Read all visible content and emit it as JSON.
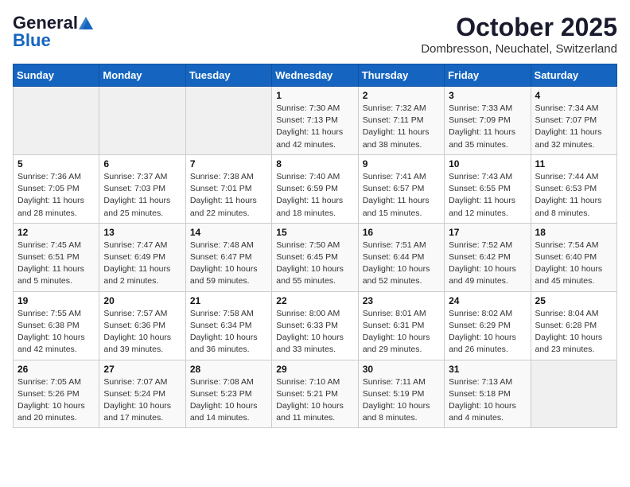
{
  "header": {
    "logo_general": "General",
    "logo_blue": "Blue",
    "title": "October 2025",
    "subtitle": "Dombresson, Neuchatel, Switzerland"
  },
  "weekdays": [
    "Sunday",
    "Monday",
    "Tuesday",
    "Wednesday",
    "Thursday",
    "Friday",
    "Saturday"
  ],
  "weeks": [
    [
      {
        "day": "",
        "info": ""
      },
      {
        "day": "",
        "info": ""
      },
      {
        "day": "",
        "info": ""
      },
      {
        "day": "1",
        "info": "Sunrise: 7:30 AM\nSunset: 7:13 PM\nDaylight: 11 hours\nand 42 minutes."
      },
      {
        "day": "2",
        "info": "Sunrise: 7:32 AM\nSunset: 7:11 PM\nDaylight: 11 hours\nand 38 minutes."
      },
      {
        "day": "3",
        "info": "Sunrise: 7:33 AM\nSunset: 7:09 PM\nDaylight: 11 hours\nand 35 minutes."
      },
      {
        "day": "4",
        "info": "Sunrise: 7:34 AM\nSunset: 7:07 PM\nDaylight: 11 hours\nand 32 minutes."
      }
    ],
    [
      {
        "day": "5",
        "info": "Sunrise: 7:36 AM\nSunset: 7:05 PM\nDaylight: 11 hours\nand 28 minutes."
      },
      {
        "day": "6",
        "info": "Sunrise: 7:37 AM\nSunset: 7:03 PM\nDaylight: 11 hours\nand 25 minutes."
      },
      {
        "day": "7",
        "info": "Sunrise: 7:38 AM\nSunset: 7:01 PM\nDaylight: 11 hours\nand 22 minutes."
      },
      {
        "day": "8",
        "info": "Sunrise: 7:40 AM\nSunset: 6:59 PM\nDaylight: 11 hours\nand 18 minutes."
      },
      {
        "day": "9",
        "info": "Sunrise: 7:41 AM\nSunset: 6:57 PM\nDaylight: 11 hours\nand 15 minutes."
      },
      {
        "day": "10",
        "info": "Sunrise: 7:43 AM\nSunset: 6:55 PM\nDaylight: 11 hours\nand 12 minutes."
      },
      {
        "day": "11",
        "info": "Sunrise: 7:44 AM\nSunset: 6:53 PM\nDaylight: 11 hours\nand 8 minutes."
      }
    ],
    [
      {
        "day": "12",
        "info": "Sunrise: 7:45 AM\nSunset: 6:51 PM\nDaylight: 11 hours\nand 5 minutes."
      },
      {
        "day": "13",
        "info": "Sunrise: 7:47 AM\nSunset: 6:49 PM\nDaylight: 11 hours\nand 2 minutes."
      },
      {
        "day": "14",
        "info": "Sunrise: 7:48 AM\nSunset: 6:47 PM\nDaylight: 10 hours\nand 59 minutes."
      },
      {
        "day": "15",
        "info": "Sunrise: 7:50 AM\nSunset: 6:45 PM\nDaylight: 10 hours\nand 55 minutes."
      },
      {
        "day": "16",
        "info": "Sunrise: 7:51 AM\nSunset: 6:44 PM\nDaylight: 10 hours\nand 52 minutes."
      },
      {
        "day": "17",
        "info": "Sunrise: 7:52 AM\nSunset: 6:42 PM\nDaylight: 10 hours\nand 49 minutes."
      },
      {
        "day": "18",
        "info": "Sunrise: 7:54 AM\nSunset: 6:40 PM\nDaylight: 10 hours\nand 45 minutes."
      }
    ],
    [
      {
        "day": "19",
        "info": "Sunrise: 7:55 AM\nSunset: 6:38 PM\nDaylight: 10 hours\nand 42 minutes."
      },
      {
        "day": "20",
        "info": "Sunrise: 7:57 AM\nSunset: 6:36 PM\nDaylight: 10 hours\nand 39 minutes."
      },
      {
        "day": "21",
        "info": "Sunrise: 7:58 AM\nSunset: 6:34 PM\nDaylight: 10 hours\nand 36 minutes."
      },
      {
        "day": "22",
        "info": "Sunrise: 8:00 AM\nSunset: 6:33 PM\nDaylight: 10 hours\nand 33 minutes."
      },
      {
        "day": "23",
        "info": "Sunrise: 8:01 AM\nSunset: 6:31 PM\nDaylight: 10 hours\nand 29 minutes."
      },
      {
        "day": "24",
        "info": "Sunrise: 8:02 AM\nSunset: 6:29 PM\nDaylight: 10 hours\nand 26 minutes."
      },
      {
        "day": "25",
        "info": "Sunrise: 8:04 AM\nSunset: 6:28 PM\nDaylight: 10 hours\nand 23 minutes."
      }
    ],
    [
      {
        "day": "26",
        "info": "Sunrise: 7:05 AM\nSunset: 5:26 PM\nDaylight: 10 hours\nand 20 minutes."
      },
      {
        "day": "27",
        "info": "Sunrise: 7:07 AM\nSunset: 5:24 PM\nDaylight: 10 hours\nand 17 minutes."
      },
      {
        "day": "28",
        "info": "Sunrise: 7:08 AM\nSunset: 5:23 PM\nDaylight: 10 hours\nand 14 minutes."
      },
      {
        "day": "29",
        "info": "Sunrise: 7:10 AM\nSunset: 5:21 PM\nDaylight: 10 hours\nand 11 minutes."
      },
      {
        "day": "30",
        "info": "Sunrise: 7:11 AM\nSunset: 5:19 PM\nDaylight: 10 hours\nand 8 minutes."
      },
      {
        "day": "31",
        "info": "Sunrise: 7:13 AM\nSunset: 5:18 PM\nDaylight: 10 hours\nand 4 minutes."
      },
      {
        "day": "",
        "info": ""
      }
    ]
  ]
}
